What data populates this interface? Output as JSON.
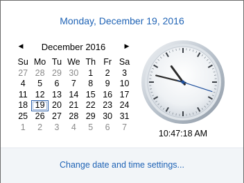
{
  "header": {
    "date_text": "Monday, December 19, 2016"
  },
  "calendar": {
    "prev_icon": "triangle-left-icon",
    "next_icon": "triangle-right-icon",
    "month_label": "December 2016",
    "weekdays": [
      "Su",
      "Mo",
      "Tu",
      "We",
      "Th",
      "Fr",
      "Sa"
    ],
    "weeks": [
      [
        {
          "d": "27",
          "other": true
        },
        {
          "d": "28",
          "other": true
        },
        {
          "d": "29",
          "other": true
        },
        {
          "d": "30",
          "other": true
        },
        {
          "d": "1"
        },
        {
          "d": "2"
        },
        {
          "d": "3"
        }
      ],
      [
        {
          "d": "4"
        },
        {
          "d": "5"
        },
        {
          "d": "6"
        },
        {
          "d": "7"
        },
        {
          "d": "8"
        },
        {
          "d": "9"
        },
        {
          "d": "10"
        }
      ],
      [
        {
          "d": "11"
        },
        {
          "d": "12"
        },
        {
          "d": "13"
        },
        {
          "d": "14"
        },
        {
          "d": "15"
        },
        {
          "d": "16"
        },
        {
          "d": "17"
        }
      ],
      [
        {
          "d": "18"
        },
        {
          "d": "19",
          "today": true
        },
        {
          "d": "20"
        },
        {
          "d": "21"
        },
        {
          "d": "22"
        },
        {
          "d": "23"
        },
        {
          "d": "24"
        }
      ],
      [
        {
          "d": "25"
        },
        {
          "d": "26"
        },
        {
          "d": "27"
        },
        {
          "d": "28"
        },
        {
          "d": "29"
        },
        {
          "d": "30"
        },
        {
          "d": "31"
        }
      ],
      [
        {
          "d": "1",
          "other": true
        },
        {
          "d": "2",
          "other": true
        },
        {
          "d": "3",
          "other": true
        },
        {
          "d": "4",
          "other": true
        },
        {
          "d": "5",
          "other": true
        },
        {
          "d": "6",
          "other": true
        },
        {
          "d": "7",
          "other": true
        }
      ]
    ]
  },
  "clock": {
    "time_text": "10:47:18 AM",
    "hours": 10,
    "minutes": 47,
    "seconds": 18,
    "icon": "analog-clock-icon"
  },
  "footer": {
    "link_text": "Change date and time settings..."
  },
  "colors": {
    "accent": "#1f63b5",
    "other_month": "#8a8a8a",
    "second_hand": "#1e4f9c"
  }
}
